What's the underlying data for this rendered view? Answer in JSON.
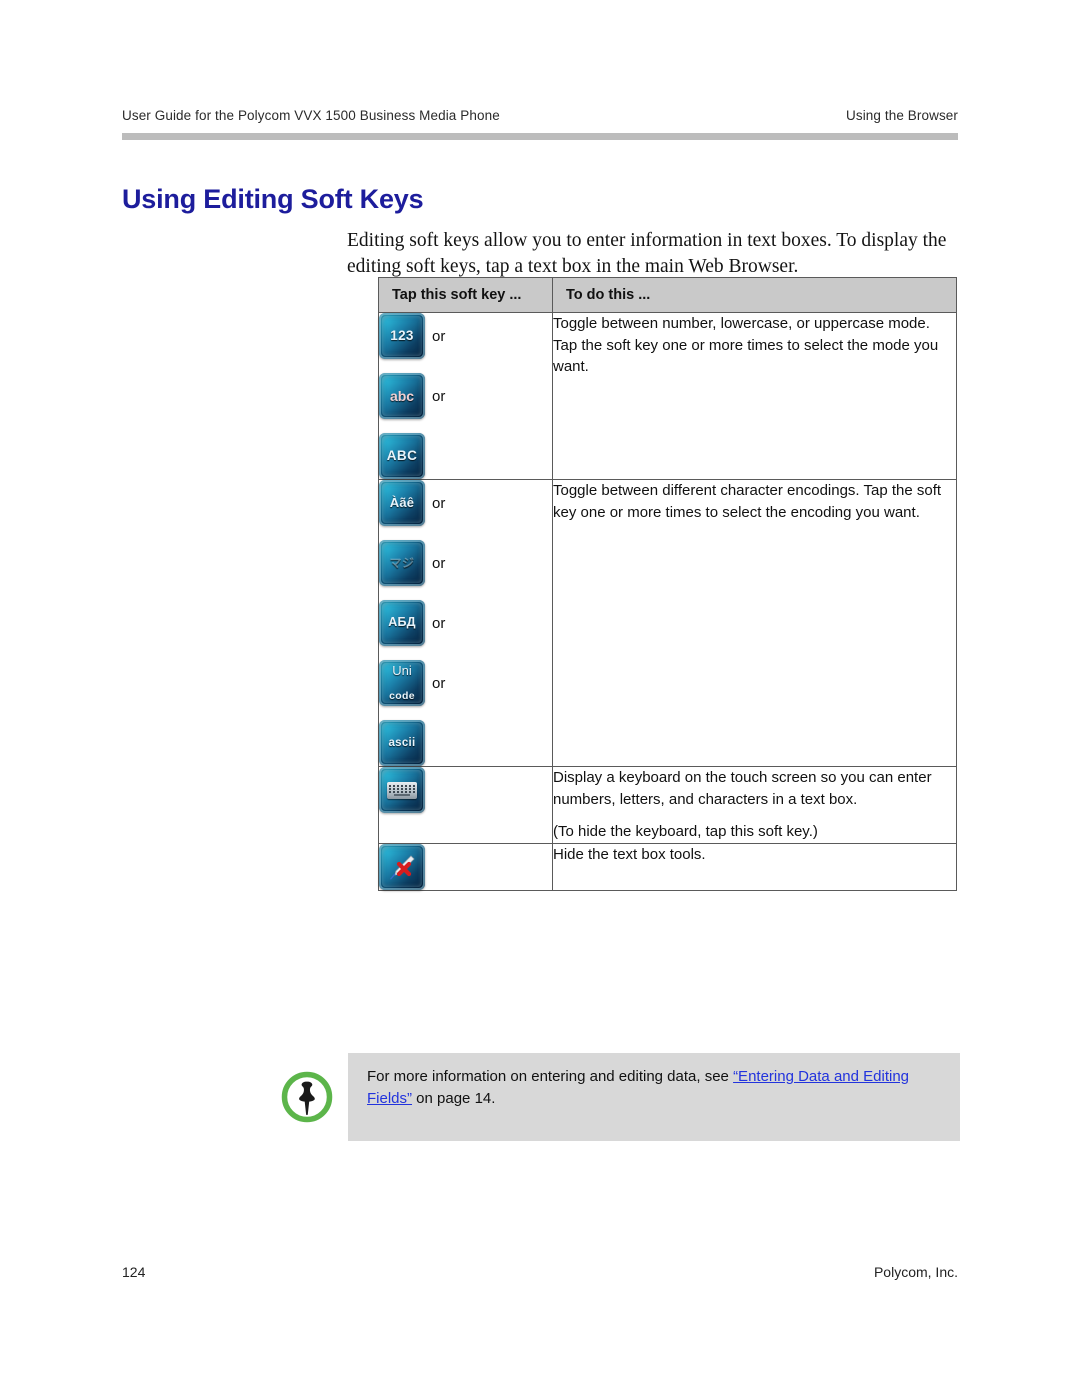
{
  "header": {
    "left": "User Guide for the Polycom VVX 1500 Business Media Phone",
    "right": "Using the Browser"
  },
  "section": {
    "title": "Using Editing Soft Keys",
    "title_color": "#1d1d9c",
    "intro": "Editing soft keys allow you to enter information in text boxes. To display the editing soft keys, tap a text box in the main Web Browser."
  },
  "table": {
    "header_bg": "#c9c9c9",
    "columns": [
      "Tap this soft key ...",
      "To do this ..."
    ],
    "rows": [
      {
        "keys": [
          {
            "icon": "softkey-123",
            "label": "123",
            "style": "sk-123",
            "separator": "or"
          },
          {
            "icon": "softkey-abc",
            "label": "abc",
            "style": "sk-abc",
            "separator": "or"
          },
          {
            "icon": "softkey-ABC",
            "label": "ABC",
            "style": "sk-ABC",
            "separator": ""
          }
        ],
        "desc": [
          "Toggle between number, lowercase, or uppercase mode. Tap the soft key one or more times to select the mode you want."
        ]
      },
      {
        "keys": [
          {
            "icon": "softkey-latin-accented",
            "label": "Àãê",
            "style": "sk-accent",
            "separator": "or"
          },
          {
            "icon": "softkey-katakana",
            "label": "マジ",
            "style": "sk-kana",
            "separator": "or"
          },
          {
            "icon": "softkey-cyrillic",
            "label": "АБД",
            "style": "sk-cyr",
            "separator": "or"
          },
          {
            "icon": "softkey-unicode",
            "label_top": "Uni",
            "label_bottom": "code",
            "style": "sk-unicode",
            "separator": "or"
          },
          {
            "icon": "softkey-ascii",
            "label": "ascii",
            "style": "sk-ascii",
            "separator": ""
          }
        ],
        "desc": [
          "Toggle between different character encodings. Tap the soft key one or more times to select the encoding you want."
        ]
      },
      {
        "keys": [
          {
            "icon": "softkey-keyboard",
            "glyph": "keyboard",
            "separator": ""
          }
        ],
        "desc": [
          "Display a keyboard on the touch screen so you can enter numbers, letters, and characters in a text box.",
          "(To hide the keyboard, tap this soft key.)"
        ]
      },
      {
        "keys": [
          {
            "icon": "softkey-hide-tools",
            "glyph": "pen-x",
            "separator": ""
          }
        ],
        "desc": [
          "Hide the text box tools."
        ]
      }
    ]
  },
  "note": {
    "icon": "pushpin-icon",
    "icon_ring_color": "#5cb54a",
    "bg": "#d8d8d8",
    "text_before": "For more information on entering and editing data, see ",
    "link_text": "“Entering Data and Editing Fields”",
    "text_after": " on page 14.",
    "link_color": "#2233dd"
  },
  "footer": {
    "page_number": "124",
    "company": "Polycom, Inc."
  }
}
